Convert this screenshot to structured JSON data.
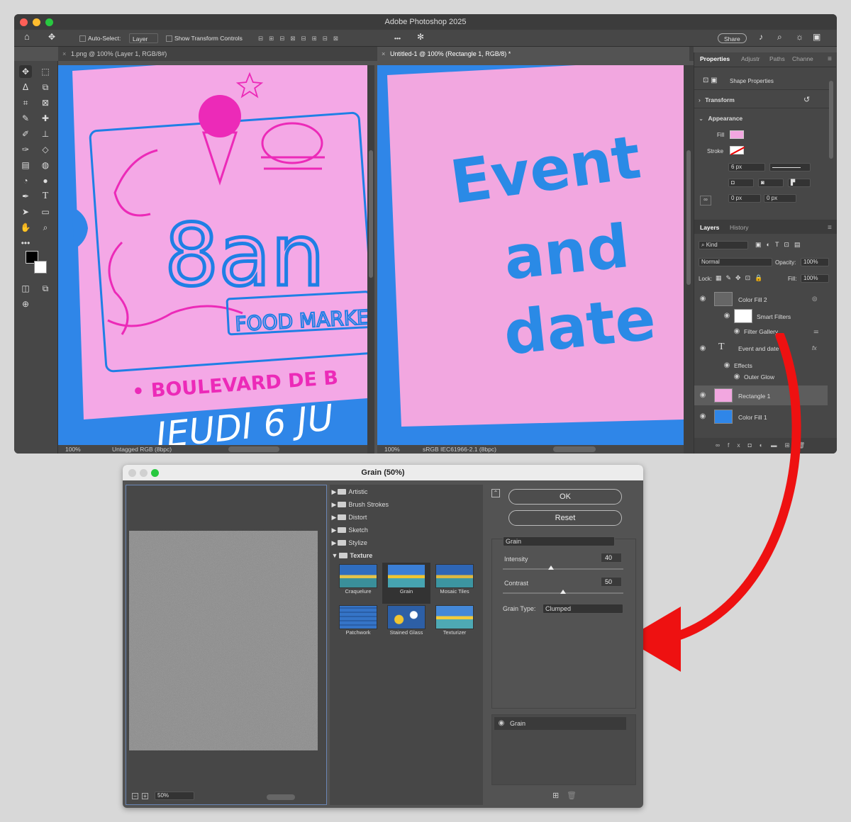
{
  "app": {
    "title": "Adobe Photoshop 2025",
    "options": {
      "auto_select": "Auto-Select:",
      "auto_select_value": "Layer",
      "show_transform": "Show Transform Controls",
      "more": "•••",
      "share": "Share"
    },
    "tabs": [
      {
        "label": "1.png @ 100% (Layer 1, RGB/8#)"
      },
      {
        "label": "Untitled-1 @ 100% (Rectangle 1, RGB/8) *"
      }
    ],
    "docs": [
      {
        "zoom": "100%",
        "profile": "Untagged RGB (8bpc)",
        "lines": [
          "8an",
          "FOOD MARKE",
          "• BOULEVARD DE B",
          "JEUDI 6 JU"
        ]
      },
      {
        "zoom": "100%",
        "profile": "sRGB IEC61966-2.1 (8bpc)",
        "lines": [
          "Event",
          "and",
          "date"
        ]
      }
    ],
    "properties": {
      "tabs": [
        "Properties",
        "Adjustr",
        "Paths",
        "Channe"
      ],
      "shape_props": "Shape Properties",
      "transform": "Transform",
      "appearance": "Appearance",
      "fill_label": "Fill",
      "stroke_label": "Stroke",
      "stroke_size": "6 px",
      "corner_a": "0 px",
      "corner_b": "0 px"
    },
    "layers_panel": {
      "tabs": [
        "Layers",
        "History"
      ],
      "kind": "Kind",
      "blend": "Normal",
      "opacity_label": "Opacity:",
      "opacity": "100%",
      "lock_label": "Lock:",
      "fill_label": "Fill:",
      "fill": "100%",
      "layers": [
        {
          "name": "Color Fill 2"
        },
        {
          "name": "Smart Filters"
        },
        {
          "name": "Filter Gallery"
        },
        {
          "name": "Event and date"
        },
        {
          "name": "Effects"
        },
        {
          "name": "Outer Glow"
        },
        {
          "name": "Rectangle 1"
        },
        {
          "name": "Color Fill 1"
        }
      ]
    }
  },
  "dialog": {
    "title": "Grain (50%)",
    "zoom": "50%",
    "categories": [
      "Artistic",
      "Brush Strokes",
      "Distort",
      "Sketch",
      "Stylize",
      "Texture"
    ],
    "filters": [
      "Craquelure",
      "Grain",
      "Mosaic Tiles",
      "Patchwork",
      "Stained Glass",
      "Texturizer"
    ],
    "ok": "OK",
    "reset": "Reset",
    "filter_select": "Grain",
    "intensity_label": "Intensity",
    "intensity": 40,
    "contrast_label": "Contrast",
    "contrast": 50,
    "grain_type_label": "Grain Type:",
    "grain_type": "Clumped",
    "applied": "Grain"
  },
  "colors": {
    "accent_blue": "#1e88e5",
    "pink": "#f2a7e0",
    "magenta": "#ec2ab8",
    "arrow": "#ee1111"
  }
}
